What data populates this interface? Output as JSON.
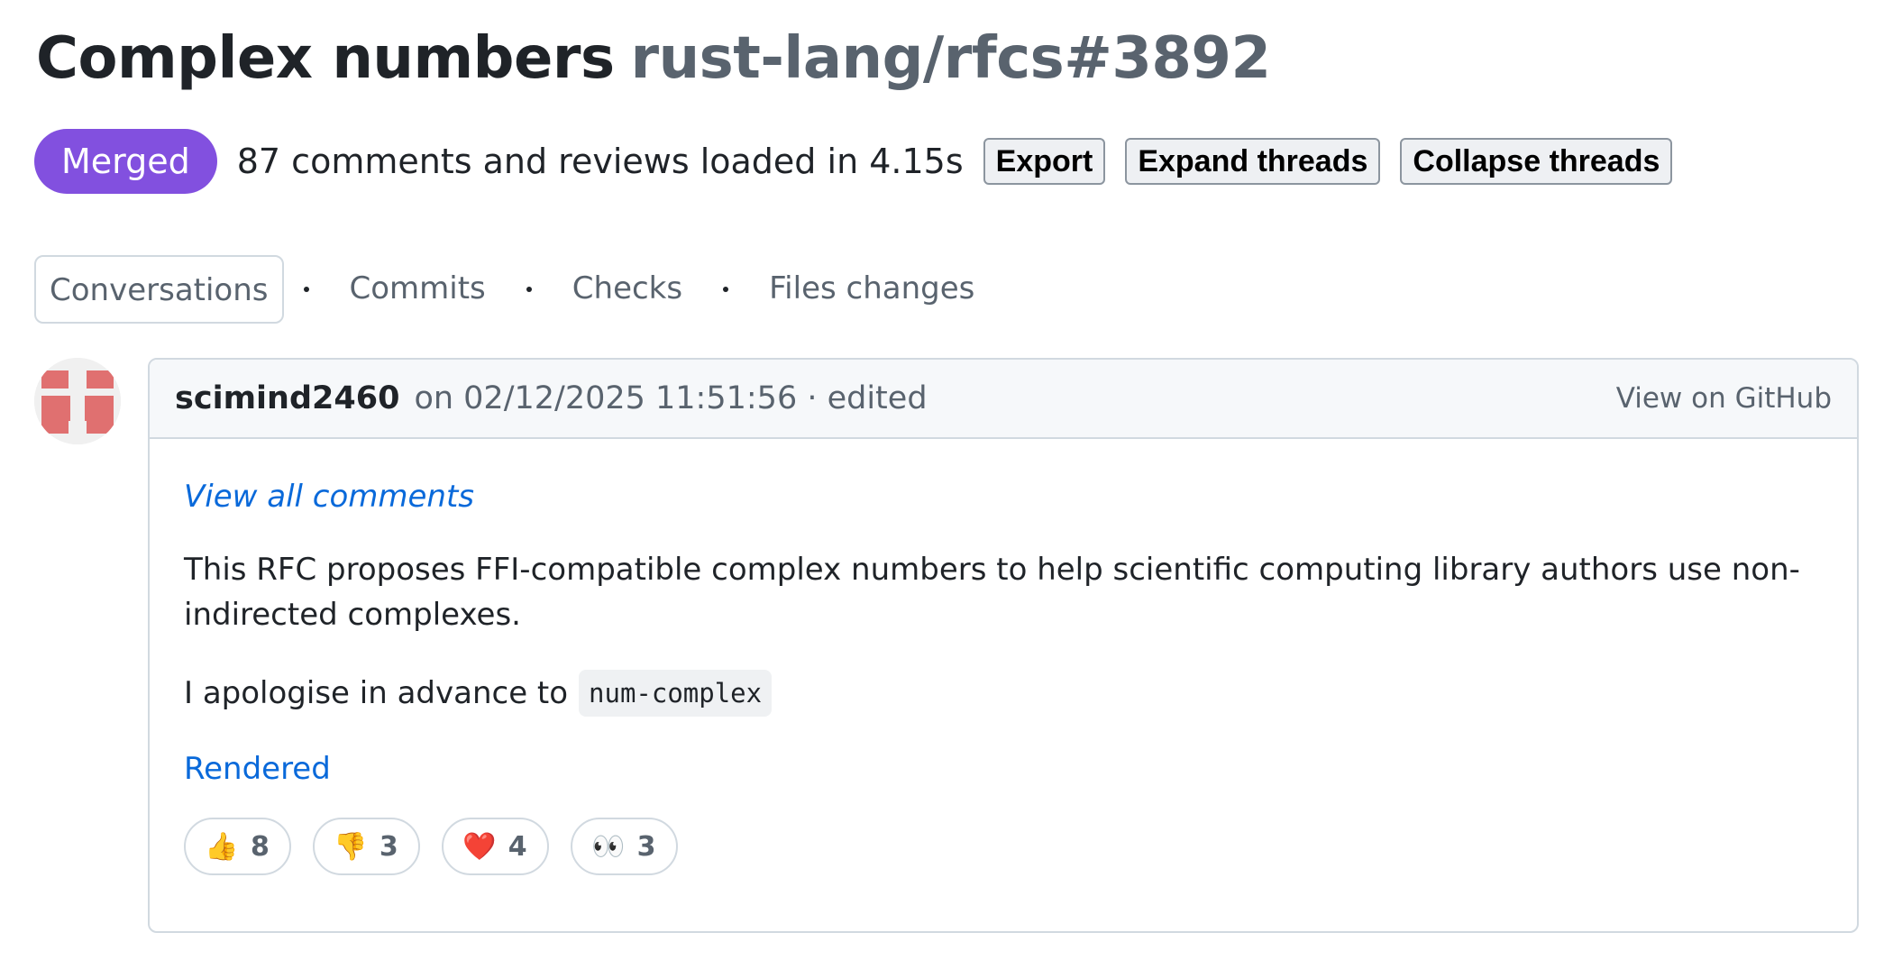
{
  "header": {
    "title": "Complex numbers",
    "ref": "rust-lang/rfcs#3892"
  },
  "status": {
    "badge": "Merged",
    "badge_color": "#8250df",
    "loaded_text": "87 comments and reviews loaded in 4.15s",
    "buttons": {
      "export": "Export",
      "expand": "Expand threads",
      "collapse": "Collapse threads"
    }
  },
  "tabs": [
    {
      "label": "Conversations",
      "active": true
    },
    {
      "label": "Commits",
      "active": false
    },
    {
      "label": "Checks",
      "active": false
    },
    {
      "label": "Files changes",
      "active": false
    }
  ],
  "comment": {
    "avatar_icon": "identicon-avatar",
    "avatar_color": "#e07070",
    "author": "scimind2460",
    "meta": "on 02/12/2025 11:51:56 · edited",
    "view_on_github": "View on GitHub",
    "view_all": "View all comments",
    "body_paragraph": "This RFC proposes FFI-compatible complex numbers to help scientific computing library authors use non-indirected complexes.",
    "apology_prefix": "I apologise in advance to",
    "apology_code": "num-complex",
    "rendered_link": "Rendered",
    "reactions": [
      {
        "icon": "thumbs-up-icon",
        "emoji": "👍",
        "count": "8"
      },
      {
        "icon": "thumbs-down-icon",
        "emoji": "👎",
        "count": "3"
      },
      {
        "icon": "heart-icon",
        "emoji": "❤️",
        "count": "4"
      },
      {
        "icon": "eyes-icon",
        "emoji": "👀",
        "count": "3"
      }
    ]
  }
}
